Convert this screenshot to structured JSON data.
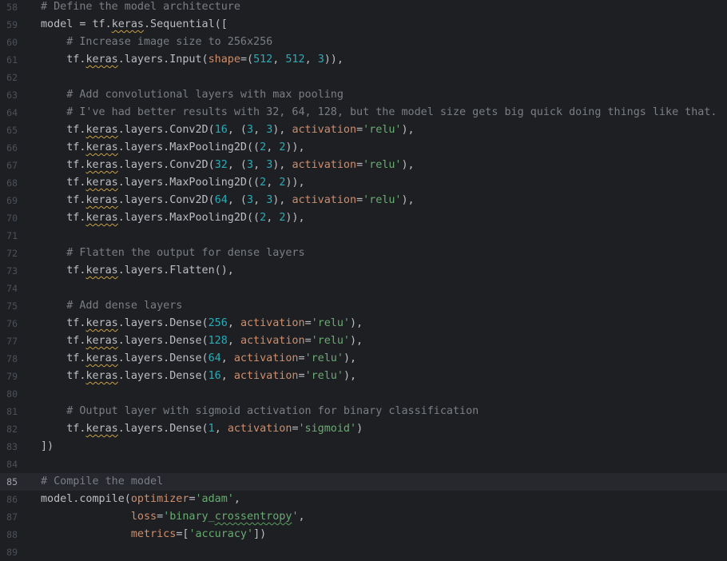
{
  "editor": {
    "theme": {
      "background": "#1e1f22",
      "current_line_bg": "#26282e",
      "comment": "#7a7e85",
      "string": "#6aab73",
      "number": "#2aacb8",
      "keyword_arg": "#cf8e6d",
      "text": "#bcbec4"
    },
    "current_line": 85,
    "lines": [
      {
        "no": "58",
        "tokens": [
          {
            "c": "comment",
            "t": "# Define the model architecture"
          }
        ]
      },
      {
        "no": "59",
        "tokens": [
          {
            "c": "plain",
            "t": "model = tf."
          },
          {
            "c": "plain warn",
            "t": "keras"
          },
          {
            "c": "plain",
            "t": ".Sequential(["
          }
        ]
      },
      {
        "no": "60",
        "tokens": [
          {
            "c": "plain",
            "t": "    "
          },
          {
            "c": "comment",
            "t": "# Increase image size to 256x256"
          }
        ]
      },
      {
        "no": "61",
        "tokens": [
          {
            "c": "plain",
            "t": "    tf."
          },
          {
            "c": "plain warn",
            "t": "keras"
          },
          {
            "c": "plain",
            "t": ".layers.Input("
          },
          {
            "c": "param",
            "t": "shape"
          },
          {
            "c": "plain",
            "t": "=("
          },
          {
            "c": "num",
            "t": "512"
          },
          {
            "c": "plain",
            "t": ", "
          },
          {
            "c": "num",
            "t": "512"
          },
          {
            "c": "plain",
            "t": ", "
          },
          {
            "c": "num",
            "t": "3"
          },
          {
            "c": "plain",
            "t": ")),"
          }
        ]
      },
      {
        "no": "62",
        "tokens": []
      },
      {
        "no": "63",
        "tokens": [
          {
            "c": "plain",
            "t": "    "
          },
          {
            "c": "comment",
            "t": "# Add convolutional layers with max pooling"
          }
        ]
      },
      {
        "no": "64",
        "tokens": [
          {
            "c": "plain",
            "t": "    "
          },
          {
            "c": "comment",
            "t": "# I've had better results with 32, 64, 128, but the model size gets big quick doing things like that."
          }
        ]
      },
      {
        "no": "65",
        "tokens": [
          {
            "c": "plain",
            "t": "    tf."
          },
          {
            "c": "plain warn",
            "t": "keras"
          },
          {
            "c": "plain",
            "t": ".layers.Conv2D("
          },
          {
            "c": "num",
            "t": "16"
          },
          {
            "c": "plain",
            "t": ", ("
          },
          {
            "c": "num",
            "t": "3"
          },
          {
            "c": "plain",
            "t": ", "
          },
          {
            "c": "num",
            "t": "3"
          },
          {
            "c": "plain",
            "t": "), "
          },
          {
            "c": "param",
            "t": "activation"
          },
          {
            "c": "plain",
            "t": "="
          },
          {
            "c": "str",
            "t": "'relu'"
          },
          {
            "c": "plain",
            "t": "),"
          }
        ]
      },
      {
        "no": "66",
        "tokens": [
          {
            "c": "plain",
            "t": "    tf."
          },
          {
            "c": "plain warn",
            "t": "keras"
          },
          {
            "c": "plain",
            "t": ".layers.MaxPooling2D(("
          },
          {
            "c": "num",
            "t": "2"
          },
          {
            "c": "plain",
            "t": ", "
          },
          {
            "c": "num",
            "t": "2"
          },
          {
            "c": "plain",
            "t": ")),"
          }
        ]
      },
      {
        "no": "67",
        "tokens": [
          {
            "c": "plain",
            "t": "    tf."
          },
          {
            "c": "plain warn",
            "t": "keras"
          },
          {
            "c": "plain",
            "t": ".layers.Conv2D("
          },
          {
            "c": "num",
            "t": "32"
          },
          {
            "c": "plain",
            "t": ", ("
          },
          {
            "c": "num",
            "t": "3"
          },
          {
            "c": "plain",
            "t": ", "
          },
          {
            "c": "num",
            "t": "3"
          },
          {
            "c": "plain",
            "t": "), "
          },
          {
            "c": "param",
            "t": "activation"
          },
          {
            "c": "plain",
            "t": "="
          },
          {
            "c": "str",
            "t": "'relu'"
          },
          {
            "c": "plain",
            "t": "),"
          }
        ]
      },
      {
        "no": "68",
        "tokens": [
          {
            "c": "plain",
            "t": "    tf."
          },
          {
            "c": "plain warn",
            "t": "keras"
          },
          {
            "c": "plain",
            "t": ".layers.MaxPooling2D(("
          },
          {
            "c": "num",
            "t": "2"
          },
          {
            "c": "plain",
            "t": ", "
          },
          {
            "c": "num",
            "t": "2"
          },
          {
            "c": "plain",
            "t": ")),"
          }
        ]
      },
      {
        "no": "69",
        "tokens": [
          {
            "c": "plain",
            "t": "    tf."
          },
          {
            "c": "plain warn",
            "t": "keras"
          },
          {
            "c": "plain",
            "t": ".layers.Conv2D("
          },
          {
            "c": "num",
            "t": "64"
          },
          {
            "c": "plain",
            "t": ", ("
          },
          {
            "c": "num",
            "t": "3"
          },
          {
            "c": "plain",
            "t": ", "
          },
          {
            "c": "num",
            "t": "3"
          },
          {
            "c": "plain",
            "t": "), "
          },
          {
            "c": "param",
            "t": "activation"
          },
          {
            "c": "plain",
            "t": "="
          },
          {
            "c": "str",
            "t": "'relu'"
          },
          {
            "c": "plain",
            "t": "),"
          }
        ]
      },
      {
        "no": "70",
        "tokens": [
          {
            "c": "plain",
            "t": "    tf."
          },
          {
            "c": "plain warn",
            "t": "keras"
          },
          {
            "c": "plain",
            "t": ".layers.MaxPooling2D(("
          },
          {
            "c": "num",
            "t": "2"
          },
          {
            "c": "plain",
            "t": ", "
          },
          {
            "c": "num",
            "t": "2"
          },
          {
            "c": "plain",
            "t": ")),"
          }
        ]
      },
      {
        "no": "71",
        "tokens": []
      },
      {
        "no": "72",
        "tokens": [
          {
            "c": "plain",
            "t": "    "
          },
          {
            "c": "comment",
            "t": "# Flatten the output for dense layers"
          }
        ]
      },
      {
        "no": "73",
        "tokens": [
          {
            "c": "plain",
            "t": "    tf."
          },
          {
            "c": "plain warn",
            "t": "keras"
          },
          {
            "c": "plain",
            "t": ".layers.Flatten(),"
          }
        ]
      },
      {
        "no": "74",
        "tokens": []
      },
      {
        "no": "75",
        "tokens": [
          {
            "c": "plain",
            "t": "    "
          },
          {
            "c": "comment",
            "t": "# Add dense layers"
          }
        ]
      },
      {
        "no": "76",
        "tokens": [
          {
            "c": "plain",
            "t": "    tf."
          },
          {
            "c": "plain warn",
            "t": "keras"
          },
          {
            "c": "plain",
            "t": ".layers.Dense("
          },
          {
            "c": "num",
            "t": "256"
          },
          {
            "c": "plain",
            "t": ", "
          },
          {
            "c": "param",
            "t": "activation"
          },
          {
            "c": "plain",
            "t": "="
          },
          {
            "c": "str",
            "t": "'relu'"
          },
          {
            "c": "plain",
            "t": "),"
          }
        ]
      },
      {
        "no": "77",
        "tokens": [
          {
            "c": "plain",
            "t": "    tf."
          },
          {
            "c": "plain warn",
            "t": "keras"
          },
          {
            "c": "plain",
            "t": ".layers.Dense("
          },
          {
            "c": "num",
            "t": "128"
          },
          {
            "c": "plain",
            "t": ", "
          },
          {
            "c": "param",
            "t": "activation"
          },
          {
            "c": "plain",
            "t": "="
          },
          {
            "c": "str",
            "t": "'relu'"
          },
          {
            "c": "plain",
            "t": "),"
          }
        ]
      },
      {
        "no": "78",
        "tokens": [
          {
            "c": "plain",
            "t": "    tf."
          },
          {
            "c": "plain warn",
            "t": "keras"
          },
          {
            "c": "plain",
            "t": ".layers.Dense("
          },
          {
            "c": "num",
            "t": "64"
          },
          {
            "c": "plain",
            "t": ", "
          },
          {
            "c": "param",
            "t": "activation"
          },
          {
            "c": "plain",
            "t": "="
          },
          {
            "c": "str",
            "t": "'relu'"
          },
          {
            "c": "plain",
            "t": "),"
          }
        ]
      },
      {
        "no": "79",
        "tokens": [
          {
            "c": "plain",
            "t": "    tf."
          },
          {
            "c": "plain warn",
            "t": "keras"
          },
          {
            "c": "plain",
            "t": ".layers.Dense("
          },
          {
            "c": "num",
            "t": "16"
          },
          {
            "c": "plain",
            "t": ", "
          },
          {
            "c": "param",
            "t": "activation"
          },
          {
            "c": "plain",
            "t": "="
          },
          {
            "c": "str",
            "t": "'relu'"
          },
          {
            "c": "plain",
            "t": "),"
          }
        ]
      },
      {
        "no": "80",
        "tokens": []
      },
      {
        "no": "81",
        "tokens": [
          {
            "c": "plain",
            "t": "    "
          },
          {
            "c": "comment",
            "t": "# Output layer with sigmoid activation for binary classification"
          }
        ]
      },
      {
        "no": "82",
        "tokens": [
          {
            "c": "plain",
            "t": "    tf."
          },
          {
            "c": "plain warn",
            "t": "keras"
          },
          {
            "c": "plain",
            "t": ".layers.Dense("
          },
          {
            "c": "num",
            "t": "1"
          },
          {
            "c": "plain",
            "t": ", "
          },
          {
            "c": "param",
            "t": "activation"
          },
          {
            "c": "plain",
            "t": "="
          },
          {
            "c": "str",
            "t": "'sigmoid'"
          },
          {
            "c": "plain",
            "t": ")"
          }
        ]
      },
      {
        "no": "83",
        "tokens": [
          {
            "c": "plain",
            "t": "])"
          }
        ]
      },
      {
        "no": "84",
        "tokens": []
      },
      {
        "no": "85",
        "tokens": [
          {
            "c": "comment",
            "t": "# Compile the model"
          }
        ]
      },
      {
        "no": "86",
        "tokens": [
          {
            "c": "plain",
            "t": "model.compile("
          },
          {
            "c": "param",
            "t": "optimizer"
          },
          {
            "c": "plain",
            "t": "="
          },
          {
            "c": "str",
            "t": "'adam'"
          },
          {
            "c": "plain",
            "t": ","
          }
        ]
      },
      {
        "no": "87",
        "tokens": [
          {
            "c": "plain",
            "t": "              "
          },
          {
            "c": "param",
            "t": "loss"
          },
          {
            "c": "plain",
            "t": "="
          },
          {
            "c": "str",
            "t": "'binary_"
          },
          {
            "c": "str typo",
            "t": "crossentropy"
          },
          {
            "c": "str",
            "t": "'"
          },
          {
            "c": "plain",
            "t": ","
          }
        ]
      },
      {
        "no": "88",
        "tokens": [
          {
            "c": "plain",
            "t": "              "
          },
          {
            "c": "param",
            "t": "metrics"
          },
          {
            "c": "plain",
            "t": "=["
          },
          {
            "c": "str",
            "t": "'accuracy'"
          },
          {
            "c": "plain",
            "t": "])"
          }
        ]
      },
      {
        "no": "89",
        "tokens": []
      }
    ]
  }
}
